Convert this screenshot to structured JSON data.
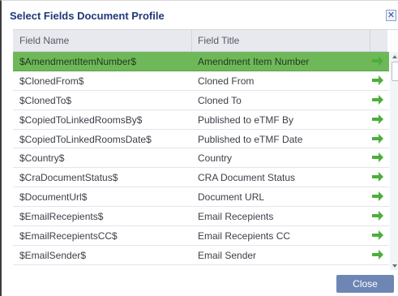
{
  "dialog": {
    "title": "Select Fields Document Profile",
    "close_icon": "close-icon",
    "close_button_label": "Close"
  },
  "grid": {
    "columns": [
      "Field Name",
      "Field Title"
    ],
    "selected_row_color": "#6fb85a",
    "arrow_color": "#4caf3a",
    "rows": [
      {
        "name": "$AmendmentItemNumber$",
        "title": "Amendment Item Number",
        "selected": true
      },
      {
        "name": "$ClonedFrom$",
        "title": "Cloned From",
        "selected": false
      },
      {
        "name": "$ClonedTo$",
        "title": "Cloned To",
        "selected": false
      },
      {
        "name": "$CopiedToLinkedRoomsBy$",
        "title": "Published to eTMF By",
        "selected": false
      },
      {
        "name": "$CopiedToLinkedRoomsDate$",
        "title": "Published to eTMF Date",
        "selected": false
      },
      {
        "name": "$Country$",
        "title": "Country",
        "selected": false
      },
      {
        "name": "$CraDocumentStatus$",
        "title": "CRA Document Status",
        "selected": false
      },
      {
        "name": "$DocumentUrl$",
        "title": "Document URL",
        "selected": false
      },
      {
        "name": "$EmailRecepients$",
        "title": "Email Recepients",
        "selected": false
      },
      {
        "name": "$EmailRecepientsCC$",
        "title": "Email Recepients CC",
        "selected": false
      },
      {
        "name": "$EmailSender$",
        "title": "Email Sender",
        "selected": false
      }
    ]
  }
}
